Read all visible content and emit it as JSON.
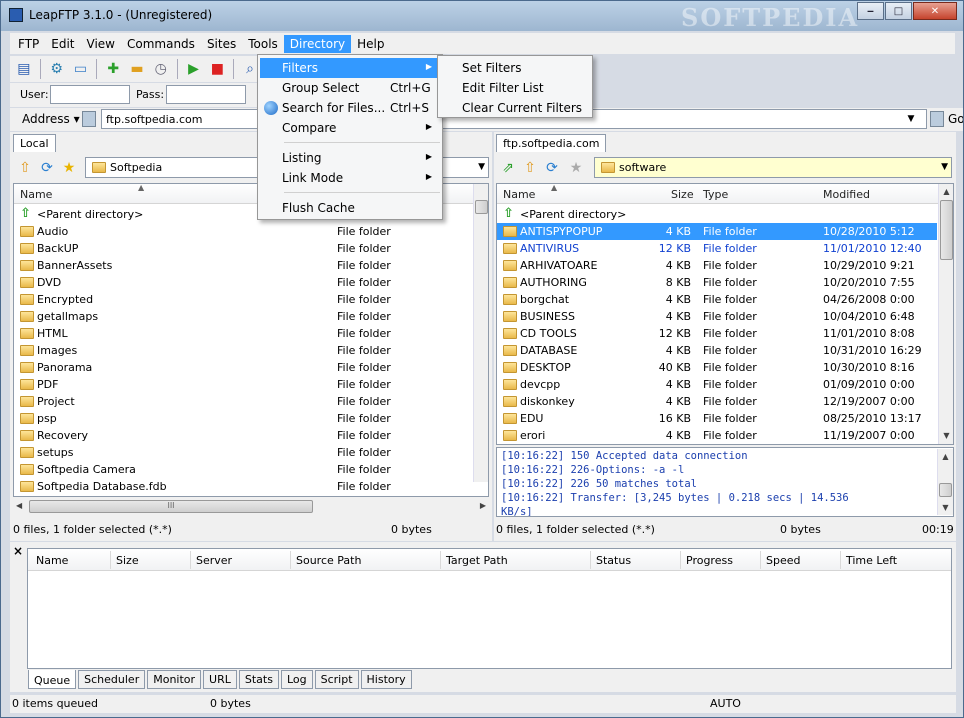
{
  "window": {
    "title": "LeapFTP 3.1.0 - (Unregistered)",
    "watermark": "SOFTPEDIA",
    "controls": [
      "minimize",
      "maximize",
      "close"
    ]
  },
  "menubar": [
    "FTP",
    "Edit",
    "View",
    "Commands",
    "Sites",
    "Tools",
    "Directory",
    "Help"
  ],
  "active_menu": "Directory",
  "toolbar_icons": [
    "site-manager-icon",
    "settings-icon",
    "folder-icon",
    "add-icon",
    "remove-icon",
    "clock-icon",
    "play-icon",
    "stop-icon",
    "search-icon"
  ],
  "login": {
    "user_label": "User:",
    "pass_label": "Pass:",
    "user_value": "",
    "pass_value": ""
  },
  "address": {
    "label": "Address",
    "value": "ftp.softpedia.com",
    "go_label": "Go"
  },
  "directory_menu": {
    "items": [
      {
        "label": "Filters",
        "shortcut": "",
        "submenu": true,
        "highlighted": true,
        "icon": ""
      },
      {
        "label": "Group Select",
        "shortcut": "Ctrl+G",
        "submenu": false,
        "highlighted": false,
        "icon": ""
      },
      {
        "label": "Search for Files...",
        "shortcut": "Ctrl+S",
        "submenu": false,
        "highlighted": false,
        "icon": "globe-icon"
      },
      {
        "label": "Compare",
        "shortcut": "",
        "submenu": true,
        "highlighted": false,
        "icon": ""
      },
      {
        "label": "Listing",
        "shortcut": "",
        "submenu": true,
        "highlighted": false,
        "icon": ""
      },
      {
        "label": "Link Mode",
        "shortcut": "",
        "submenu": true,
        "highlighted": false,
        "icon": ""
      },
      {
        "label": "Flush Cache",
        "shortcut": "",
        "submenu": false,
        "highlighted": false,
        "icon": ""
      }
    ]
  },
  "filters_submenu": [
    "Set Filters",
    "Edit Filter List",
    "Clear Current Filters"
  ],
  "local": {
    "tab": "Local",
    "path": "Softpedia",
    "columns": [
      "Name"
    ],
    "parent": "<Parent directory>",
    "rows": [
      {
        "name": "Audio",
        "type": "File folder"
      },
      {
        "name": "BackUP",
        "type": "File folder"
      },
      {
        "name": "BannerAssets",
        "type": "File folder"
      },
      {
        "name": "DVD",
        "type": "File folder"
      },
      {
        "name": "Encrypted",
        "type": "File folder"
      },
      {
        "name": "getallmaps",
        "type": "File folder"
      },
      {
        "name": "HTML",
        "type": "File folder"
      },
      {
        "name": "Images",
        "type": "File folder"
      },
      {
        "name": "Panorama",
        "type": "File folder"
      },
      {
        "name": "PDF",
        "type": "File folder"
      },
      {
        "name": "Project",
        "type": "File folder"
      },
      {
        "name": "psp",
        "type": "File folder"
      },
      {
        "name": "Recovery",
        "type": "File folder"
      },
      {
        "name": "setups",
        "type": "File folder"
      },
      {
        "name": "Softpedia Camera",
        "type": "File folder"
      },
      {
        "name": "Softpedia Database.fdb",
        "type": "File folder"
      }
    ],
    "status_left": "0 files, 1 folder selected (*.*)",
    "status_right": "0 bytes"
  },
  "remote": {
    "tab": "ftp.softpedia.com",
    "path": "software",
    "columns": [
      "Name",
      "Size",
      "Type",
      "Modified"
    ],
    "parent": "<Parent directory>",
    "rows": [
      {
        "name": "ANTISPYPOPUP",
        "size": "4 KB",
        "type": "File folder",
        "modified": "10/28/2010 5:12",
        "state": "selected"
      },
      {
        "name": "ANTIVIRUS",
        "size": "12 KB",
        "type": "File folder",
        "modified": "11/01/2010 12:40",
        "state": "blue"
      },
      {
        "name": "ARHIVATOARE",
        "size": "4 KB",
        "type": "File folder",
        "modified": "10/29/2010 9:21",
        "state": ""
      },
      {
        "name": "AUTHORING",
        "size": "8 KB",
        "type": "File folder",
        "modified": "10/20/2010 7:55",
        "state": ""
      },
      {
        "name": "borgchat",
        "size": "4 KB",
        "type": "File folder",
        "modified": "04/26/2008 0:00",
        "state": ""
      },
      {
        "name": "BUSINESS",
        "size": "4 KB",
        "type": "File folder",
        "modified": "10/04/2010 6:48",
        "state": ""
      },
      {
        "name": "CD TOOLS",
        "size": "12 KB",
        "type": "File folder",
        "modified": "11/01/2010 8:08",
        "state": ""
      },
      {
        "name": "DATABASE",
        "size": "4 KB",
        "type": "File folder",
        "modified": "10/31/2010 16:29",
        "state": ""
      },
      {
        "name": "DESKTOP",
        "size": "40 KB",
        "type": "File folder",
        "modified": "10/30/2010 8:16",
        "state": ""
      },
      {
        "name": "devcpp",
        "size": "4 KB",
        "type": "File folder",
        "modified": "01/09/2010 0:00",
        "state": ""
      },
      {
        "name": "diskonkey",
        "size": "4 KB",
        "type": "File folder",
        "modified": "12/19/2007 0:00",
        "state": ""
      },
      {
        "name": "EDU",
        "size": "16 KB",
        "type": "File folder",
        "modified": "08/25/2010 13:17",
        "state": ""
      },
      {
        "name": "erori",
        "size": "4 KB",
        "type": "File folder",
        "modified": "11/19/2007 0:00",
        "state": ""
      }
    ],
    "log": [
      "[10:16:22] 150 Accepted data connection",
      "[10:16:22] 226-Options: -a -l",
      "[10:16:22] 226 50 matches total",
      "[10:16:22] Transfer: [3,245 bytes | 0.218 secs | 14.536",
      "KB/s]"
    ],
    "status_left": "0 files, 1 folder selected (*.*)",
    "status_mid": "0 bytes",
    "status_right": "00:19"
  },
  "queue": {
    "columns": [
      "Name",
      "Size",
      "Server",
      "Source Path",
      "Target Path",
      "Status",
      "Progress",
      "Speed",
      "Time Left"
    ],
    "tabs": [
      "Queue",
      "Scheduler",
      "Monitor",
      "URL",
      "Stats",
      "Log",
      "Script",
      "History"
    ],
    "active_tab": "Queue",
    "status_left": "0 items queued",
    "status_mid": "0 bytes",
    "status_right": "AUTO",
    "close_glyph": "×"
  },
  "colors": {
    "selection": "#3399ff",
    "link_blue": "#1040d0",
    "log_text": "#1b3fae"
  }
}
